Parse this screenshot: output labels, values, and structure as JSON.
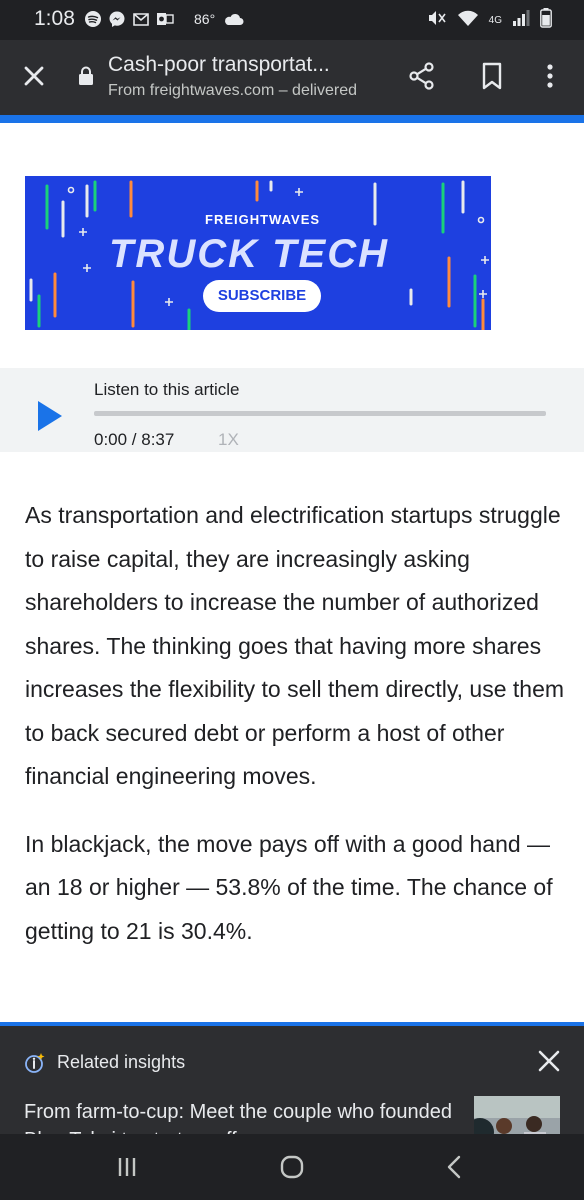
{
  "status_bar": {
    "time": "1:08",
    "temperature": "86°",
    "network": "4G",
    "icons_left": [
      "spotify-icon",
      "messenger-icon",
      "gmail-icon",
      "outlook-icon",
      "weather-icon"
    ],
    "icons_right": [
      "mute-icon",
      "wifi-icon",
      "signal-icon",
      "battery-icon"
    ]
  },
  "toolbar": {
    "title": "Cash-poor transportat...",
    "url": "From freightwaves.com – delivered"
  },
  "banner": {
    "brand": "FREIGHTWAVES",
    "headline": "TRUCK TECH",
    "cta": "SUBSCRIBE",
    "bg_color": "#1e40e0"
  },
  "player": {
    "label": "Listen to this article",
    "time": "0:00 / 8:37",
    "speed": "1X",
    "progress": 0
  },
  "article": {
    "paragraphs": [
      "As transportation and electrification startups struggle to raise capital, they are increasingly asking shareholders to increase the number of authorized shares. The thinking goes that having more shares increases the flexibility to sell them directly, use them to back secured debt or perform a host of other financial engineering moves.",
      "In blackjack, the move pays off with a good hand — an 18 or higher — 53.8% of the time. The chance of getting to 21 is 30.4%."
    ]
  },
  "related": {
    "title": "Related insights",
    "headline": "From farm-to-cup: Meet the couple who founded Blue Tokai to start a coffee"
  },
  "colors": {
    "accent": "#1a73e8",
    "toolbar_bg": "#2d2e31"
  }
}
